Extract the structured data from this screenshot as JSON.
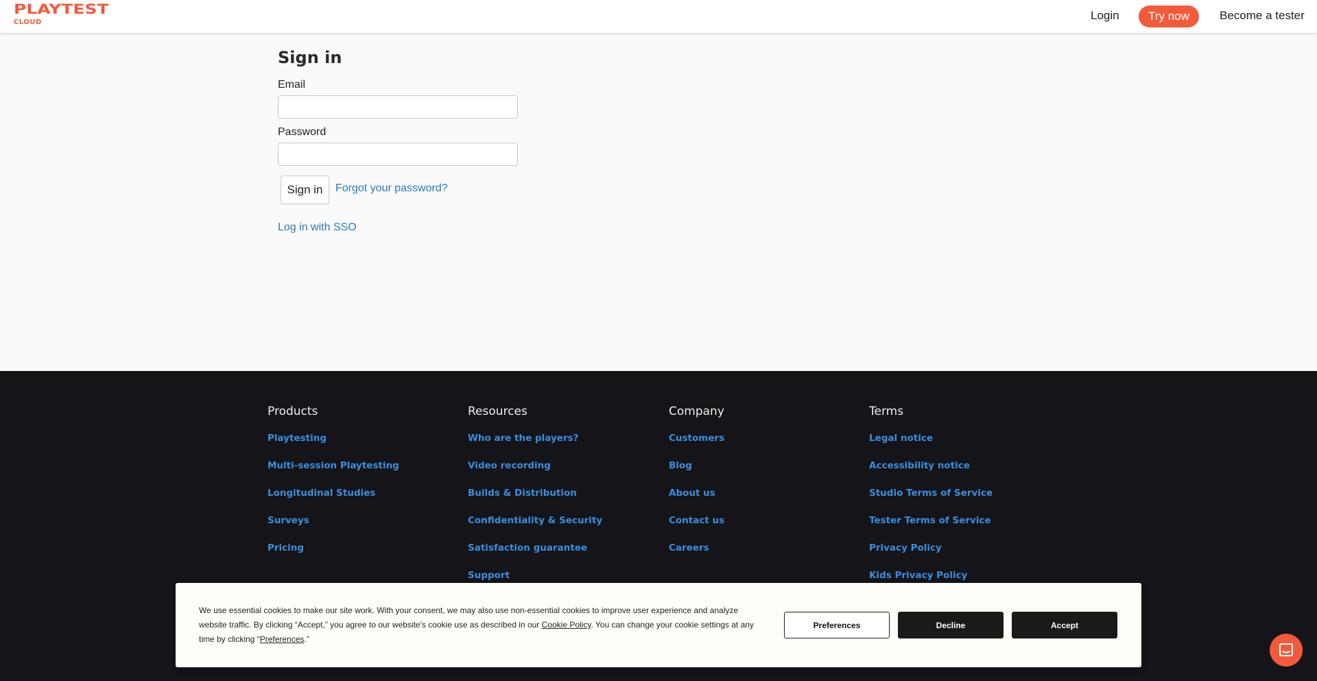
{
  "header": {
    "logo_top": "PLAYTEST",
    "logo_bottom": "CLOUD",
    "login_label": "Login",
    "try_label": "Try now",
    "tester_label": "Become a tester"
  },
  "signin": {
    "title": "Sign in",
    "email_label": "Email",
    "email_value": "",
    "password_label": "Password",
    "password_value": "",
    "submit_label": "Sign in",
    "forgot_label": "Forgot your password?",
    "sso_label": "Log in with SSO"
  },
  "footer": {
    "columns": [
      {
        "title": "Products",
        "links": [
          "Playtesting",
          "Multi-session Playtesting",
          "Longitudinal Studies",
          "Surveys",
          "Pricing"
        ]
      },
      {
        "title": "Resources",
        "links": [
          "Who are the players?",
          "Video recording",
          "Builds & Distribution",
          "Confidentiality & Security",
          "Satisfaction guarantee",
          "Support"
        ]
      },
      {
        "title": "Company",
        "links": [
          "Customers",
          "Blog",
          "About us",
          "Contact us",
          "Careers"
        ]
      },
      {
        "title": "Terms",
        "links": [
          "Legal notice",
          "Accessibility notice",
          "Studio Terms of Service",
          "Tester Terms of Service",
          "Privacy Policy",
          "Kids Privacy Policy"
        ]
      }
    ]
  },
  "cookie": {
    "text_part1": "We use essential cookies to make our site work. With your consent, we may also use non-essential cookies to improve user experience and analyze website traffic. By clicking “Accept,” you agree to our website's cookie use as described in our ",
    "policy_link": "Cookie Policy",
    "text_part2": ". You can change your cookie settings at any time by clicking “",
    "pref_link": "Preferences",
    "text_part3": ".”",
    "preferences_label": "Preferences",
    "decline_label": "Decline",
    "accept_label": "Accept"
  },
  "chat": {
    "icon": "chat-icon"
  },
  "colors": {
    "brand": "#f25a3c",
    "footer_bg": "#141419",
    "footer_link": "#3b8ede",
    "link": "#2a7ab8"
  }
}
